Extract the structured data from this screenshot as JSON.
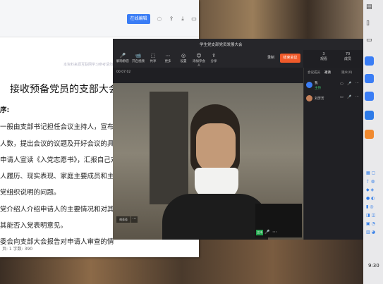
{
  "document": {
    "edit_label": "在线编辑",
    "watermark": "本资料来源互联网学习参考请勿商用",
    "title": "接收预备党员的支部大会",
    "lines": [
      "序:",
      "一般由支部书记担任会议主持人，宣布开",
      "人数，提出会议的议题及开好会议的具体",
      "申请人宣读《入党志愿书》，汇报自己对",
      "人履历、现实表现、家庭主要成员和主要社",
      "党组织说明的问题。",
      "党介绍人介绍申请人的主要情况和对其",
      "其能否入党表明意见。",
      "委会向支部大会报告对申请人审查的情"
    ],
    "status": "页: 1  字数: 390"
  },
  "meeting": {
    "title": "学生党支部党员发展大会",
    "timer": "00:07:02",
    "toolbar": [
      {
        "icon": "🎤",
        "label": "解除静音"
      },
      {
        "icon": "📹",
        "label": "开启视频"
      },
      {
        "icon": "⬚",
        "label": "共享"
      },
      {
        "icon": "⋯",
        "label": "更多"
      },
      {
        "icon": "◎",
        "label": "设置"
      },
      {
        "icon": "☺",
        "label": "添加参会人"
      },
      {
        "icon": "⇪",
        "label": "分享"
      }
    ],
    "record_label": "录制",
    "end_label": "结束会议",
    "participant_count": "3",
    "participant_count_label": "观看",
    "right_count": "70",
    "right_count_label": "成员",
    "video_name_tag": "刘芳芳",
    "self_tag": "主持"
  },
  "panel": {
    "tabs": [
      "会议成员",
      "邀请",
      "观众(0)"
    ],
    "participants": [
      {
        "name": "我",
        "role": "主持",
        "color": "#3a7df5"
      },
      {
        "name": "刘芳芳",
        "role": "",
        "color": "#c4805a"
      }
    ]
  },
  "sidebar": {
    "clock": "9:30"
  }
}
